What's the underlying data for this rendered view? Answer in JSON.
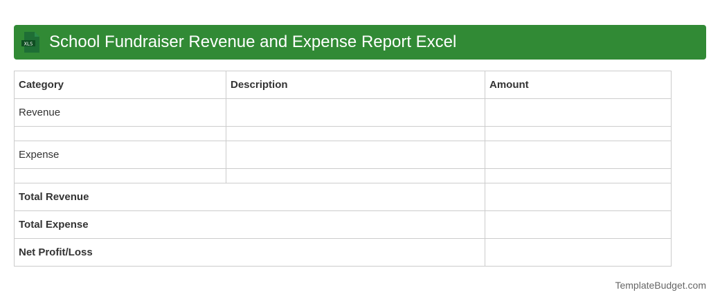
{
  "header": {
    "title": "School Fundraiser Revenue and Expense Report Excel",
    "icon_label": "XLS",
    "color": "#318a35"
  },
  "table": {
    "headers": [
      "Category",
      "Description",
      "Amount"
    ],
    "rows": [
      [
        "Revenue",
        "",
        ""
      ],
      [
        "",
        "",
        ""
      ],
      [
        "Expense",
        "",
        ""
      ],
      [
        "",
        "",
        ""
      ]
    ],
    "totals": [
      {
        "label": "Total Revenue",
        "amount": ""
      },
      {
        "label": "Total Expense",
        "amount": ""
      },
      {
        "label": "Net Profit/Loss",
        "amount": ""
      }
    ]
  },
  "footer": {
    "brand": "TemplateBudget.com"
  }
}
